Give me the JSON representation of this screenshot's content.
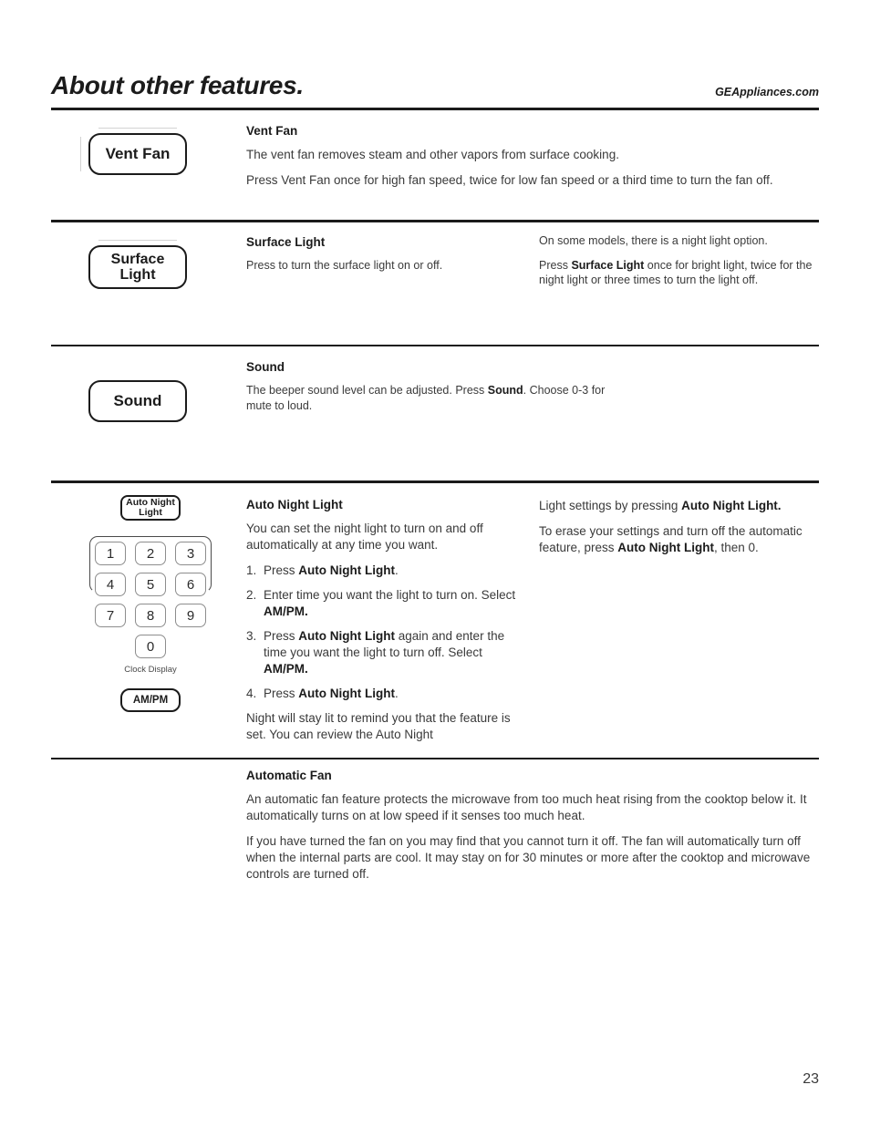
{
  "header": {
    "title": "About other features.",
    "site": "GEAppliances.com"
  },
  "sections": {
    "vent_fan": {
      "button_label": "Vent Fan",
      "heading": "Vent Fan",
      "p1": "The vent fan removes steam and other vapors from surface cooking.",
      "p2": "Press Vent Fan once for high fan speed, twice for low fan speed or a third time to turn the fan off."
    },
    "surface_light": {
      "button_line1": "Surface",
      "button_line2": "Light",
      "heading": "Surface Light",
      "p1": "Press to turn the surface light on or off.",
      "right_p1": "On some models, there is a night light option.",
      "right_p2_pre": "Press ",
      "right_p2_bold": "Surface Light",
      "right_p2_post": " once for bright light, twice for the night light or three times to turn the light off."
    },
    "sound": {
      "button_label": "Sound",
      "heading": "Sound",
      "p1_pre": "The beeper sound level can be adjusted. Press ",
      "p1_bold": "Sound",
      "p1_post": ". Choose 0-3 for mute to loud."
    },
    "auto_night_light": {
      "button_line1": "Auto Night",
      "button_line2": "Light",
      "ampm_button_label": "AM/PM",
      "clock_display_label": "Clock Display",
      "keys": [
        "1",
        "2",
        "3",
        "4",
        "5",
        "6",
        "7",
        "8",
        "9",
        "0"
      ],
      "heading": "Auto Night Light",
      "p1": "You can set the night light to turn on and off automatically at any time you want.",
      "steps": [
        {
          "num": "1.",
          "pre": "Press ",
          "bold": "Auto Night Light",
          "post": "."
        },
        {
          "num": "2.",
          "pre": "Enter time you want the light to turn on. Select ",
          "bold": "AM/PM.",
          "post": ""
        },
        {
          "num": "3.",
          "pre": "Press  ",
          "bold": "Auto Night Light",
          "post": " again and enter the time you want the light to turn off. Select ",
          "bold2": "AM/PM.",
          "post2": ""
        },
        {
          "num": "4.",
          "pre": "Press ",
          "bold": "Auto Night Light",
          "post": "."
        }
      ],
      "p_after": "Night will stay lit to remind you that the feature is set.  You can review the Auto Night",
      "right_p1_pre": "Light settings by pressing ",
      "right_p1_bold": "Auto Night Light.",
      "right_p2_pre": "To erase your settings  and turn off the automatic feature, press ",
      "right_p2_bold": "Auto Night Light",
      "right_p2_post": ", then 0."
    },
    "automatic_fan": {
      "heading": "Automatic Fan",
      "p1": "An automatic fan feature protects the microwave from too much heat rising from the cooktop below it. It automatically turns on at low speed if it senses too much heat.",
      "p2": "If you have turned the fan on you may find that you cannot turn it off. The fan will automatically turn off when the internal parts are cool. It may stay on for 30 minutes or more after the cooktop and microwave controls are turned off."
    }
  },
  "page_number": "23"
}
